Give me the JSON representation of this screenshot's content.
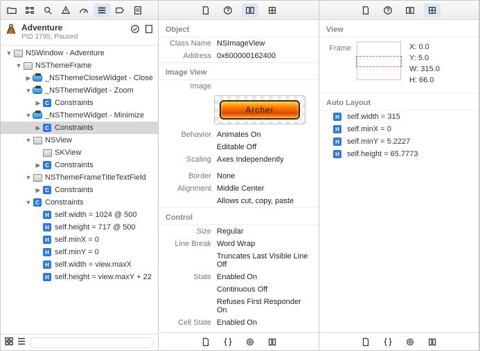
{
  "app": {
    "title": "Adventure",
    "subtitle": "PID 1795, Paused"
  },
  "tree": [
    {
      "d": 0,
      "open": true,
      "icon": "win",
      "label": "NSWindow - Adventure"
    },
    {
      "d": 1,
      "open": true,
      "icon": "win",
      "label": "NSThemeFrame"
    },
    {
      "d": 2,
      "open": false,
      "icon": "pill",
      "label": "_NSThemeCloseWidget - Close"
    },
    {
      "d": 2,
      "open": true,
      "icon": "pill",
      "label": "_NSThemeWidget - Zoom"
    },
    {
      "d": 3,
      "open": false,
      "icon": "blue",
      "g": "C",
      "label": "Constraints"
    },
    {
      "d": 2,
      "open": true,
      "icon": "pill",
      "label": "_NSThemeWidget - Minimize"
    },
    {
      "d": 3,
      "open": false,
      "icon": "blue",
      "g": "C",
      "label": "Constraints",
      "selected": true
    },
    {
      "d": 2,
      "open": true,
      "icon": "win",
      "label": "NSView"
    },
    {
      "d": 3,
      "open": null,
      "icon": "win",
      "label": "SKView"
    },
    {
      "d": 3,
      "open": false,
      "icon": "blue",
      "g": "C",
      "label": "Constraints"
    },
    {
      "d": 2,
      "open": true,
      "icon": "win",
      "label": "NSThemeFrameTitleTextField"
    },
    {
      "d": 3,
      "open": false,
      "icon": "blue",
      "g": "C",
      "label": "Constraints"
    },
    {
      "d": 2,
      "open": true,
      "icon": "blue",
      "g": "C",
      "label": "Constraints"
    },
    {
      "d": 3,
      "open": null,
      "icon": "blue",
      "g": "H",
      "label": "self.width = 1024 @ 500"
    },
    {
      "d": 3,
      "open": null,
      "icon": "blue",
      "g": "H",
      "label": "self.height = 717 @ 500"
    },
    {
      "d": 3,
      "open": null,
      "icon": "blue",
      "g": "H",
      "label": "self.minX = 0"
    },
    {
      "d": 3,
      "open": null,
      "icon": "blue",
      "g": "H",
      "label": "self.minY = 0"
    },
    {
      "d": 3,
      "open": null,
      "icon": "blue",
      "g": "H",
      "label": "self.width = view.maxX"
    },
    {
      "d": 3,
      "open": null,
      "icon": "blue",
      "g": "H",
      "label": "self.height = view.maxY + 22"
    }
  ],
  "object": {
    "heading": "Object",
    "classLabel": "Class Name",
    "className": "NSImageView",
    "addrLabel": "Address",
    "address": "0x600000162400"
  },
  "imageView": {
    "heading": "Image View",
    "imageLabel": "Image",
    "archer": "Archer",
    "behaviorLabel": "Behavior",
    "behavior1": "Animates On",
    "behavior2": "Editable Off",
    "scalingLabel": "Scaling",
    "scaling": "Axes Independently",
    "borderLabel": "Border",
    "border": "None",
    "alignLabel": "Alignment",
    "align": "Middle Center",
    "allows": "Allows cut, copy, paste"
  },
  "control": {
    "heading": "Control",
    "sizeLabel": "Size",
    "size": "Regular",
    "lbLabel": "Line Break",
    "lb1": "Word Wrap",
    "lb2": "Truncates Last Visible Line Off",
    "stateLabel": "State",
    "state1": "Enabled On",
    "state2": "Continuous Off",
    "state3": "Refuses First Responder On",
    "cellLabel": "Cell State",
    "cell": "Enabled On"
  },
  "view": {
    "heading": "View",
    "frameLabel": "Frame",
    "x": "X: 0.0",
    "y": "Y: 5.0",
    "w": "W: 315.0",
    "h": "H: 66.0"
  },
  "autoLayout": {
    "heading": "Auto Layout",
    "items": [
      {
        "g": "H",
        "t": "self.width = 315"
      },
      {
        "g": "H",
        "t": "self.minX = 0"
      },
      {
        "g": "H",
        "t": "self.minY = 5.2227"
      },
      {
        "g": "H",
        "t": "self.height = 65.7773"
      }
    ]
  }
}
